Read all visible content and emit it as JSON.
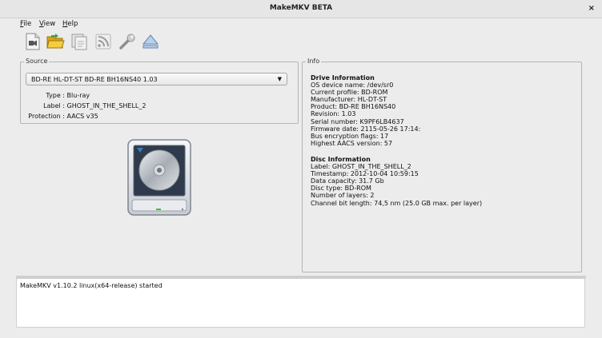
{
  "window": {
    "title": "MakeMKV BETA",
    "close_glyph": "×"
  },
  "menu": [
    {
      "first": "F",
      "rest": "ile"
    },
    {
      "first": "V",
      "rest": "iew"
    },
    {
      "first": "H",
      "rest": "elp"
    }
  ],
  "toolbar": {
    "icons": [
      "open-file-icon",
      "open-folder-icon",
      "backup-icon",
      "stream-icon",
      "settings-wrench-icon",
      "eject-icon"
    ]
  },
  "source": {
    "legend": "Source",
    "drive_selected": "BD-RE HL-DT-ST BD-RE  BH16NS40 1.03",
    "type_label": "Type :",
    "type_value": "Blu-ray",
    "label_label": "Label :",
    "label_value": "GHOST_IN_THE_SHELL_2",
    "protection_label": "Protection :",
    "protection_value": "AACS v35"
  },
  "info": {
    "legend": "Info",
    "drive_heading": "Drive Information",
    "drive_lines": [
      "OS device name: /dev/sr0",
      "Current profile: BD-ROM",
      "Manufacturer: HL-DT-ST",
      "Product: BD-RE BH16NS40",
      "Revision: 1.03",
      "Serial number: K9PF6LB4637",
      "Firmware date: 2115-05-26 17:14:",
      "Bus encryption flags: 17",
      "Highest AACS version: 57"
    ],
    "disc_heading": "Disc Information",
    "disc_lines": [
      "Label: GHOST_IN_THE_SHELL_2",
      "Timestamp: 2012-10-04 10:59:15",
      "Data capacity: 31.7 Gb",
      "Disc type: BD-ROM",
      "Number of layers: 2",
      "Channel bit length: 74,5 nm (25.0 GB max. per layer)"
    ]
  },
  "log": {
    "text": "MakeMKV v1.10.2 linux(x64-release) started"
  }
}
